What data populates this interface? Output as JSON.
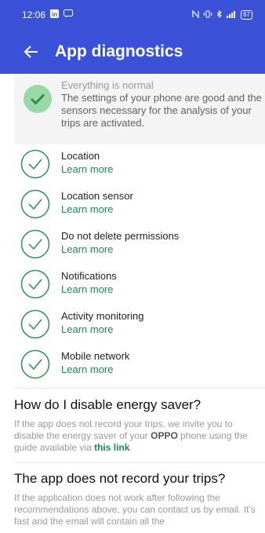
{
  "status_bar": {
    "time": "12:06",
    "left_icons": [
      "linkedin-icon",
      "chat-icon"
    ],
    "right_icons": [
      "nfc-icon",
      "vibrate-icon",
      "bluetooth-icon",
      "signal-icon",
      "battery-icon"
    ],
    "battery_level": "67"
  },
  "app_bar": {
    "title": "App diagnostics",
    "back_icon": "back-arrow-icon"
  },
  "status_card": {
    "heading": "Everything is normal",
    "description": "The settings of your phone are good and the sensors necessary for the analysis of your trips are activated.",
    "icon": "check-icon"
  },
  "checks": [
    {
      "label": "Location",
      "link": "Learn more"
    },
    {
      "label": "Location sensor",
      "link": "Learn more"
    },
    {
      "label": "Do not delete permissions",
      "link": "Learn more"
    },
    {
      "label": "Notifications",
      "link": "Learn more"
    },
    {
      "label": "Activity monitoring",
      "link": "Learn more"
    },
    {
      "label": "Mobile network",
      "link": "Learn more"
    }
  ],
  "energy_saver": {
    "title": "How do I disable energy saver?",
    "text_part1": "If the app does not record your trips, we invite you to disable the energy saver of your ",
    "brand": "OPPO",
    "text_part2": " phone using the guide available via ",
    "link_text": "this link",
    "text_part3": "."
  },
  "no_record": {
    "title": "The app does not record your trips?",
    "text": "If the application does not work after following the recommendations above, you can contact us by email. It's fast and the email will contain all the"
  },
  "colors": {
    "primary": "#3a51d8",
    "accent_green": "#1f8a55",
    "success_light": "#9bd8a8"
  }
}
